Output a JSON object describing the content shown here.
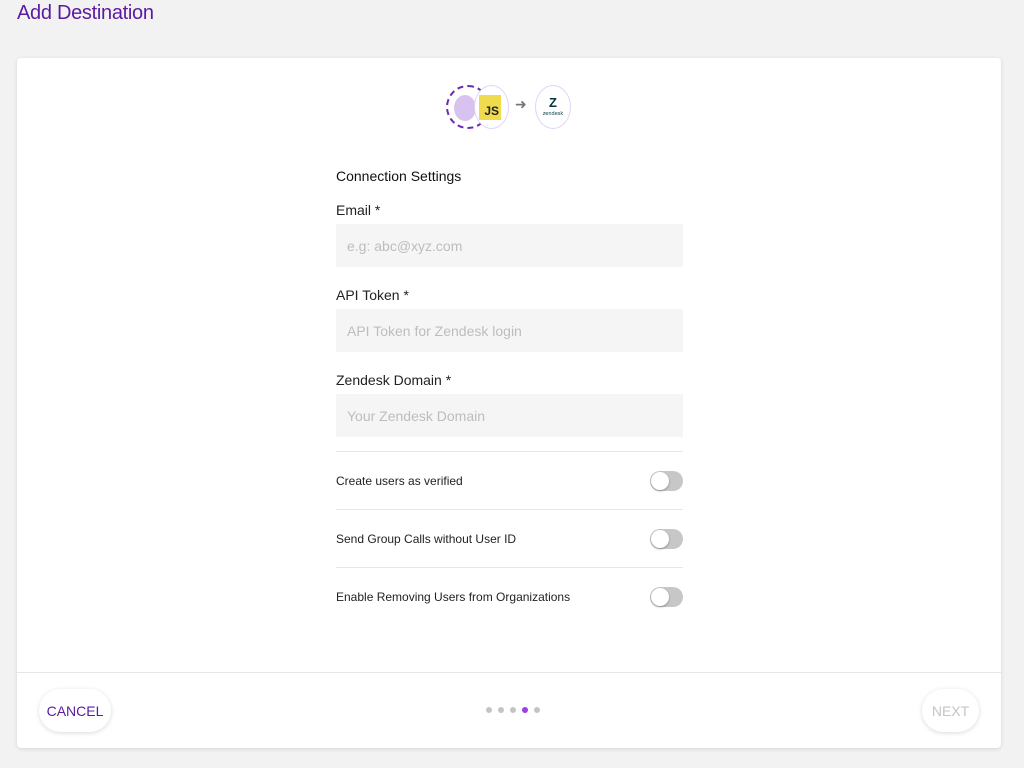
{
  "page": {
    "title": "Add Destination"
  },
  "connection": {
    "source_icon": "source-placeholder-icon",
    "source_sdk_label": "JS",
    "arrow_icon": "arrow-right-icon",
    "destination_logo_glyph": "Z",
    "destination_logo_text": "zendesk"
  },
  "form": {
    "section_title": "Connection Settings",
    "fields": [
      {
        "label": "Email *",
        "value": "",
        "placeholder": "e.g: abc@xyz.com"
      },
      {
        "label": "API Token *",
        "value": "",
        "placeholder": "API Token for Zendesk login"
      },
      {
        "label": "Zendesk Domain *",
        "value": "",
        "placeholder": "Your Zendesk Domain"
      }
    ],
    "toggles": [
      {
        "label": "Create users as verified",
        "enabled": false
      },
      {
        "label": "Send Group Calls without User ID",
        "enabled": false
      },
      {
        "label": "Enable Removing Users from Organizations",
        "enabled": false
      }
    ]
  },
  "footer": {
    "cancel_label": "CANCEL",
    "next_label": "NEXT",
    "steps_total": 5,
    "current_step": 4
  },
  "colors": {
    "brand": "#5b1aa0",
    "active_step": "#9b3ef0",
    "js_yellow": "#f0db4f"
  }
}
